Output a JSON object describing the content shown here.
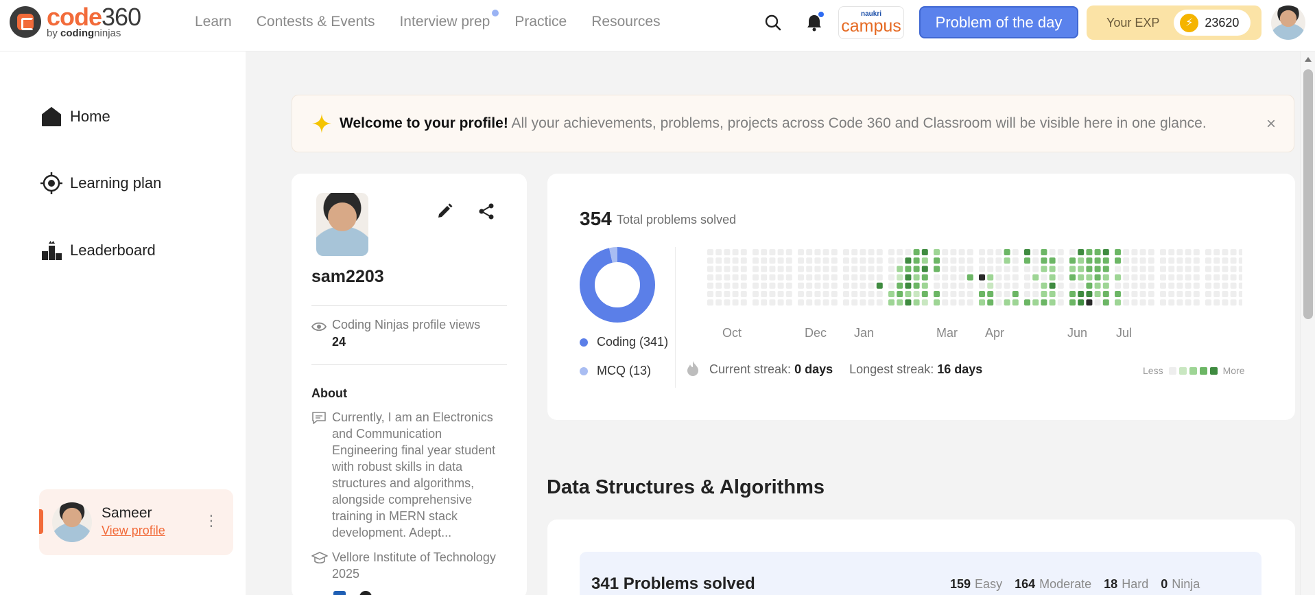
{
  "header": {
    "logo_code": "code",
    "logo_num": "360",
    "logo_by": "by",
    "logo_brand_a": "coding",
    "logo_brand_b": "ninjas",
    "nav": [
      "Learn",
      "Contests & Events",
      "Interview prep",
      "Practice",
      "Resources"
    ],
    "campus_top": "naukri",
    "campus_main": "campus",
    "potd_label": "Problem of the day",
    "exp_label": "Your EXP",
    "exp_value": "23620",
    "icons": [
      "search-icon",
      "bell-icon",
      "bolt-icon",
      "avatar"
    ],
    "accent": "#f26b3a",
    "potd_color": "#5a82ec"
  },
  "sidebar": {
    "items": [
      {
        "label": "Home",
        "icon": "home-icon"
      },
      {
        "label": "Learning plan",
        "icon": "target-icon"
      },
      {
        "label": "Leaderboard",
        "icon": "leaderboard-icon"
      }
    ],
    "user_name": "Sameer",
    "user_link": "View profile"
  },
  "banner": {
    "bold": "Welcome to your profile!",
    "text": " All your achievements, problems, projects across Code 360 and Classroom will be visible here in one glance.",
    "close": "×"
  },
  "profile": {
    "username": "sam2203",
    "views_label": "Coding Ninjas profile views",
    "views_value": "24",
    "about_title": "About",
    "about_text": "Currently, I am an Electronics and Communication Engineering final year student with robust skills in data structures and algorithms, alongside comprehensive training in MERN stack development. Adept...",
    "education": "Vellore Institute of Technology 2025"
  },
  "stats": {
    "total_value": "354",
    "total_label": "Total problems solved",
    "legend": [
      {
        "label": "Coding (341)",
        "value": 341,
        "color": "#5b7fe8"
      },
      {
        "label": "MCQ (13)",
        "value": 13,
        "color": "#a9bdf2"
      }
    ],
    "months": [
      "Oct",
      "Dec",
      "Jan",
      "Mar",
      "Apr",
      "Jun",
      "Jul"
    ],
    "current_streak_label": "Current streak:",
    "current_streak_value": "0 days",
    "longest_streak_label": "Longest streak:",
    "longest_streak_value": "16 days",
    "less": "Less",
    "more": "More",
    "heat_colors": [
      "#eeeeee",
      "#c9e7c1",
      "#9ed595",
      "#6cb665",
      "#3f8b40",
      "#2a2a2a"
    ],
    "heat_weeks": [
      [
        0,
        0,
        0,
        0,
        0,
        0,
        0
      ],
      [
        0,
        0,
        0,
        0,
        0,
        0,
        0
      ],
      [
        0,
        0,
        0,
        0,
        0,
        0,
        0
      ],
      [
        0,
        0,
        0,
        0,
        0,
        0,
        0
      ],
      [
        0,
        0,
        0,
        0,
        0,
        0,
        0
      ],
      [
        0,
        0,
        0,
        0,
        0,
        0,
        0
      ],
      [
        0,
        0,
        0,
        0,
        0,
        0,
        0
      ],
      [
        0,
        0,
        0,
        0,
        0,
        0,
        0
      ],
      [
        0,
        0,
        0,
        0,
        0,
        0,
        0
      ],
      [
        0,
        0,
        0,
        0,
        0,
        0,
        0
      ],
      [
        0,
        0,
        0,
        0,
        0,
        0,
        0
      ],
      [
        0,
        0,
        0,
        0,
        0,
        0,
        0
      ],
      [
        0,
        0,
        0,
        0,
        0,
        0,
        0
      ],
      [
        0,
        0,
        0,
        0,
        0,
        0,
        0
      ],
      [
        0,
        0,
        0,
        0,
        0,
        0,
        0
      ],
      [
        0,
        0,
        0,
        0,
        0,
        0,
        0
      ],
      [
        0,
        0,
        0,
        0,
        0,
        0,
        0
      ],
      [
        0,
        0,
        0,
        0,
        0,
        0,
        0
      ],
      [
        0,
        0,
        0,
        0,
        0,
        0,
        0
      ],
      [
        0,
        0,
        0,
        0,
        4,
        0,
        0
      ],
      [
        0,
        0,
        0,
        0,
        0,
        2,
        2
      ],
      [
        0,
        0,
        2,
        1,
        3,
        3,
        2
      ],
      [
        0,
        4,
        3,
        4,
        4,
        2,
        4
      ],
      [
        3,
        3,
        3,
        2,
        3,
        1,
        2
      ],
      [
        4,
        2,
        4,
        3,
        2,
        3,
        1
      ],
      [
        2,
        3,
        3,
        0,
        0,
        3,
        2
      ],
      [
        0,
        0,
        0,
        0,
        0,
        0,
        0
      ],
      [
        0,
        0,
        0,
        0,
        0,
        0,
        0
      ],
      [
        0,
        0,
        0,
        0,
        0,
        0,
        0
      ],
      [
        0,
        0,
        0,
        3,
        0,
        0,
        0
      ],
      [
        0,
        0,
        0,
        5,
        0,
        3,
        2
      ],
      [
        0,
        0,
        0,
        2,
        1,
        3,
        3
      ],
      [
        0,
        0,
        0,
        0,
        0,
        0,
        0
      ],
      [
        3,
        2,
        0,
        0,
        0,
        0,
        2
      ],
      [
        0,
        0,
        0,
        0,
        0,
        3,
        2
      ],
      [
        4,
        3,
        0,
        0,
        0,
        0,
        3
      ],
      [
        0,
        0,
        0,
        2,
        0,
        0,
        2
      ],
      [
        3,
        3,
        2,
        0,
        2,
        2,
        3
      ],
      [
        0,
        3,
        2,
        2,
        4,
        2,
        2
      ],
      [
        0,
        0,
        0,
        0,
        0,
        0,
        0
      ],
      [
        0,
        3,
        2,
        3,
        0,
        3,
        3
      ],
      [
        4,
        2,
        2,
        2,
        0,
        4,
        4
      ],
      [
        3,
        3,
        3,
        2,
        3,
        4,
        5
      ],
      [
        3,
        3,
        3,
        3,
        2,
        2,
        0
      ],
      [
        4,
        3,
        3,
        2,
        2,
        3,
        3
      ],
      [
        3,
        3,
        0,
        2,
        0,
        3,
        2
      ],
      [
        0,
        0,
        0,
        0,
        0,
        0,
        0
      ],
      [
        0,
        0,
        0,
        0,
        0,
        0,
        0
      ],
      [
        0,
        0,
        0,
        0,
        0,
        0,
        0
      ],
      [
        0,
        0,
        0,
        0,
        0,
        0,
        0
      ],
      [
        0,
        0,
        0,
        0,
        0,
        0,
        0
      ],
      [
        0,
        0,
        0,
        0,
        0,
        0,
        0
      ],
      [
        0,
        0,
        0,
        0,
        0,
        0,
        0
      ],
      [
        0,
        0,
        0,
        0,
        0,
        0,
        0
      ],
      [
        0,
        0,
        0,
        0,
        0,
        0,
        0
      ],
      [
        0,
        0,
        0,
        0,
        0,
        0,
        0
      ],
      [
        0,
        0,
        0,
        0,
        0,
        0,
        0
      ],
      [
        0,
        0,
        0,
        0,
        0,
        0,
        0
      ],
      [
        0,
        0,
        0,
        0,
        0,
        0,
        0
      ],
      [
        0,
        0,
        0,
        0,
        0,
        0,
        0
      ],
      [
        0,
        0,
        0,
        0,
        0,
        0,
        0
      ],
      [
        0,
        0,
        0,
        0,
        0,
        0,
        0
      ],
      [
        0,
        0,
        0,
        0,
        0,
        0,
        0
      ],
      [
        0,
        0,
        0,
        0,
        0,
        0,
        0
      ],
      [
        0,
        0,
        0,
        0,
        0,
        0,
        0
      ],
      [
        0,
        0,
        0,
        0,
        0,
        0,
        0
      ],
      [
        0,
        0,
        0,
        0,
        0,
        0,
        0
      ],
      [
        0,
        0,
        0,
        0,
        0,
        0,
        0
      ],
      [
        0,
        0,
        0,
        0,
        0,
        0,
        0
      ],
      [
        0,
        0,
        0,
        0,
        0,
        0,
        0
      ],
      [
        0,
        0,
        0,
        0,
        0,
        0,
        0
      ],
      [
        0,
        0,
        0,
        0,
        0,
        0,
        0
      ],
      [
        0,
        0,
        0,
        0,
        0,
        0,
        0
      ],
      [
        0,
        0,
        0,
        0,
        0,
        0,
        0
      ],
      [
        0,
        0,
        0,
        0,
        0,
        0,
        0
      ],
      [
        0,
        0,
        0,
        0,
        0,
        0,
        0
      ],
      [
        0,
        0,
        0,
        0,
        0,
        0,
        0
      ],
      [
        0,
        0,
        0,
        0,
        0,
        0,
        0
      ],
      [
        0,
        0,
        0,
        0,
        0,
        0,
        0
      ],
      [
        0,
        0,
        0,
        0,
        0,
        0,
        0
      ],
      [
        0,
        0,
        0,
        0,
        0,
        0,
        0
      ],
      [
        0,
        0,
        0,
        0,
        0,
        0,
        0
      ],
      [
        0,
        0,
        0,
        0,
        0,
        0,
        0
      ],
      [
        0,
        0,
        0,
        0,
        0,
        0,
        0
      ]
    ]
  },
  "dsa": {
    "title": "Data Structures & Algorithms",
    "solved": "341 Problems solved",
    "stats": [
      {
        "value": "159",
        "label": "Easy"
      },
      {
        "value": "164",
        "label": "Moderate"
      },
      {
        "value": "18",
        "label": "Hard"
      },
      {
        "value": "0",
        "label": "Ninja"
      }
    ]
  }
}
